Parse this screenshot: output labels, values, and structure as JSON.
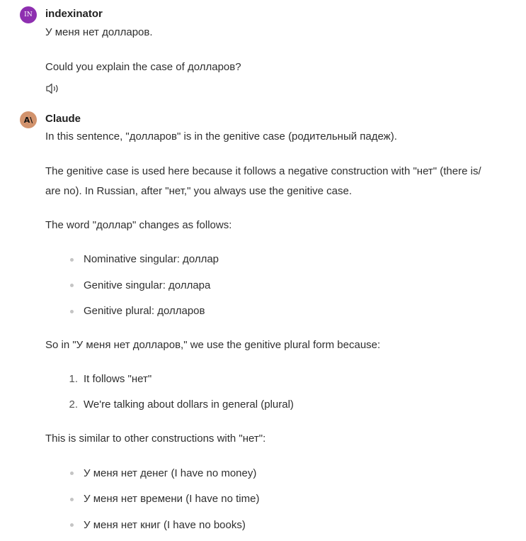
{
  "user_message": {
    "avatar_initials": "IN",
    "author": "indexinator",
    "lines": [
      "У меня нет долларов.",
      "Could you explain the case of долларов?"
    ],
    "read_aloud_icon": "speaker-icon"
  },
  "assistant_message": {
    "avatar_glyph": "A\\",
    "author": "Claude",
    "para1": "In this sentence, \"долларов\" is in the genitive case (родительный падеж).",
    "para2_line1": "The genitive case is used here because it follows a negative construction with \"нет\" (there is/",
    "para2_line2": "are no). In Russian, after \"нет,\" you always use the genitive case.",
    "para3": "The word \"доллар\" changes as follows:",
    "forms": [
      "Nominative singular: доллар",
      "Genitive singular: доллара",
      "Genitive plural: долларов"
    ],
    "para4": "So in \"У меня нет долларов,\" we use the genitive plural form because:",
    "reasons": [
      {
        "num": "1.",
        "text": "It follows \"нет\""
      },
      {
        "num": "2.",
        "text": "We're talking about dollars in general (plural)"
      }
    ],
    "para5": "This is similar to other constructions with \"нет\":",
    "examples": [
      "У меня нет денег (I have no money)",
      "У меня нет времени (I have no time)",
      "У меня нет книг (I have no books)"
    ]
  },
  "colors": {
    "user_avatar": "#8e2fb0",
    "claude_avatar": "#d2936d",
    "bullet": "#c4c4c4",
    "text": "#2f2f2f"
  }
}
